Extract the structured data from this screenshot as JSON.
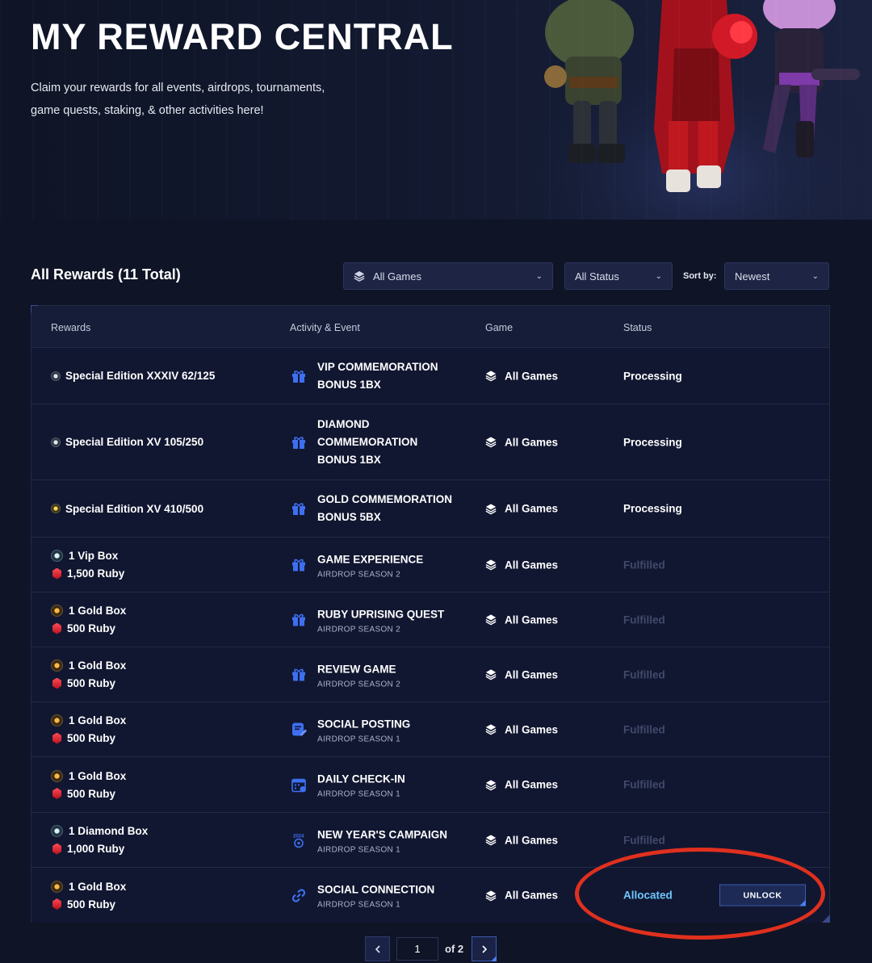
{
  "hero": {
    "title": "MY REWARD CENTRAL",
    "description": "Claim your rewards for all events, airdrops, tournaments, game quests, staking, & other activities here!"
  },
  "rewards_section": {
    "title": "All Rewards (11 Total)",
    "filters": {
      "game": "All Games",
      "status": "All Status",
      "sort_label": "Sort by:",
      "sort": "Newest"
    }
  },
  "table": {
    "headers": [
      "Rewards",
      "Activity & Event",
      "Game",
      "Status"
    ],
    "rows": [
      {
        "reward_lines": [
          {
            "icon": "silver-medal-icon",
            "text": "Special Edition XXXIV 62/125"
          }
        ],
        "activity_icon": "gift-icon",
        "activity": "VIP COMMEMORATION BONUS 1BX",
        "activity_sub": "",
        "game": "All Games",
        "status": "Processing",
        "status_type": "processing"
      },
      {
        "reward_lines": [
          {
            "icon": "silver-medal-icon",
            "text": "Special Edition XV 105/250"
          }
        ],
        "activity_icon": "gift-icon",
        "activity": "DIAMOND COMMEMORATION BONUS 1BX",
        "activity_sub": "",
        "game": "All Games",
        "status": "Processing",
        "status_type": "processing"
      },
      {
        "reward_lines": [
          {
            "icon": "gold-medal-icon",
            "text": "Special Edition XV 410/500"
          }
        ],
        "activity_icon": "gift-icon",
        "activity": "GOLD COMMEMORATION BONUS 5BX",
        "activity_sub": "",
        "game": "All Games",
        "status": "Processing",
        "status_type": "processing"
      },
      {
        "reward_lines": [
          {
            "icon": "vip-box-icon",
            "text": "1 Vip Box"
          },
          {
            "icon": "ruby-icon",
            "text": "1,500 Ruby"
          }
        ],
        "activity_icon": "gift-icon",
        "activity": "GAME EXPERIENCE",
        "activity_sub": "AIRDROP SEASON 2",
        "game": "All Games",
        "status": "Fulfilled",
        "status_type": "fulfilled"
      },
      {
        "reward_lines": [
          {
            "icon": "gold-box-icon",
            "text": "1 Gold Box"
          },
          {
            "icon": "ruby-icon",
            "text": "500 Ruby"
          }
        ],
        "activity_icon": "gift-icon",
        "activity": "RUBY UPRISING QUEST",
        "activity_sub": "AIRDROP SEASON 2",
        "game": "All Games",
        "status": "Fulfilled",
        "status_type": "fulfilled"
      },
      {
        "reward_lines": [
          {
            "icon": "gold-box-icon",
            "text": "1 Gold Box"
          },
          {
            "icon": "ruby-icon",
            "text": "500 Ruby"
          }
        ],
        "activity_icon": "gift-icon",
        "activity": "REVIEW GAME",
        "activity_sub": "AIRDROP SEASON 2",
        "game": "All Games",
        "status": "Fulfilled",
        "status_type": "fulfilled"
      },
      {
        "reward_lines": [
          {
            "icon": "gold-box-icon",
            "text": "1 Gold Box"
          },
          {
            "icon": "ruby-icon",
            "text": "500 Ruby"
          }
        ],
        "activity_icon": "post-edit-icon",
        "activity": "SOCIAL POSTING",
        "activity_sub": "AIRDROP SEASON 1",
        "game": "All Games",
        "status": "Fulfilled",
        "status_type": "fulfilled"
      },
      {
        "reward_lines": [
          {
            "icon": "gold-box-icon",
            "text": "1 Gold Box"
          },
          {
            "icon": "ruby-icon",
            "text": "500 Ruby"
          }
        ],
        "activity_icon": "calendar-check-icon",
        "activity": "DAILY CHECK-IN",
        "activity_sub": "AIRDROP SEASON 1",
        "game": "All Games",
        "status": "Fulfilled",
        "status_type": "fulfilled"
      },
      {
        "reward_lines": [
          {
            "icon": "diamond-box-icon",
            "text": "1 Diamond Box"
          },
          {
            "icon": "ruby-icon",
            "text": "1,000 Ruby"
          }
        ],
        "activity_icon": "new-year-2024-icon",
        "activity": "NEW YEAR'S CAMPAIGN",
        "activity_sub": "AIRDROP SEASON 1",
        "game": "All Games",
        "status": "Fulfilled",
        "status_type": "fulfilled"
      },
      {
        "reward_lines": [
          {
            "icon": "gold-box-icon",
            "text": "1 Gold Box"
          },
          {
            "icon": "ruby-icon",
            "text": "500 Ruby"
          }
        ],
        "activity_icon": "link-icon",
        "activity": "SOCIAL CONNECTION",
        "activity_sub": "AIRDROP SEASON 1",
        "game": "All Games",
        "status": "Allocated",
        "status_type": "allocated",
        "action": "UNLOCK"
      }
    ]
  },
  "pagination": {
    "current_page": "1",
    "of_text": "of 2"
  },
  "colors": {
    "background": "#0f1426",
    "accent_blue": "#2f6cf0",
    "allocated": "#6fc7ff",
    "fulfilled": "#414a6b",
    "annotation": "#e0301e"
  }
}
